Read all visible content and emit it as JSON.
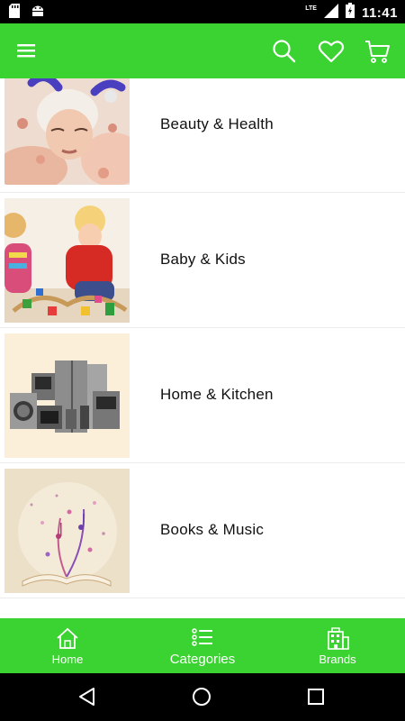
{
  "status_bar": {
    "time": "11:41",
    "network": "LTE"
  },
  "app_bar": {
    "menu_icon": "hamburger-menu-icon",
    "search_icon": "search-icon",
    "wishlist_icon": "heart-icon",
    "cart_icon": "shopping-cart-icon",
    "color": "#3bd331"
  },
  "categories": [
    {
      "label": "Beauty & Health",
      "image": "spa-facial-photo"
    },
    {
      "label": "Baby & Kids",
      "image": "children-playing-photo"
    },
    {
      "label": "Home & Kitchen",
      "image": "home-appliances-photo"
    },
    {
      "label": "Books & Music",
      "image": "open-book-music-notes-photo"
    }
  ],
  "bottom_nav": {
    "items": [
      {
        "label": "Home",
        "icon": "home-icon"
      },
      {
        "label": "Categories",
        "icon": "list-icon",
        "active": true
      },
      {
        "label": "Brands",
        "icon": "building-icon"
      }
    ]
  },
  "system_nav": {
    "back": "back-icon",
    "home": "home-circle-icon",
    "recents": "recents-icon"
  }
}
